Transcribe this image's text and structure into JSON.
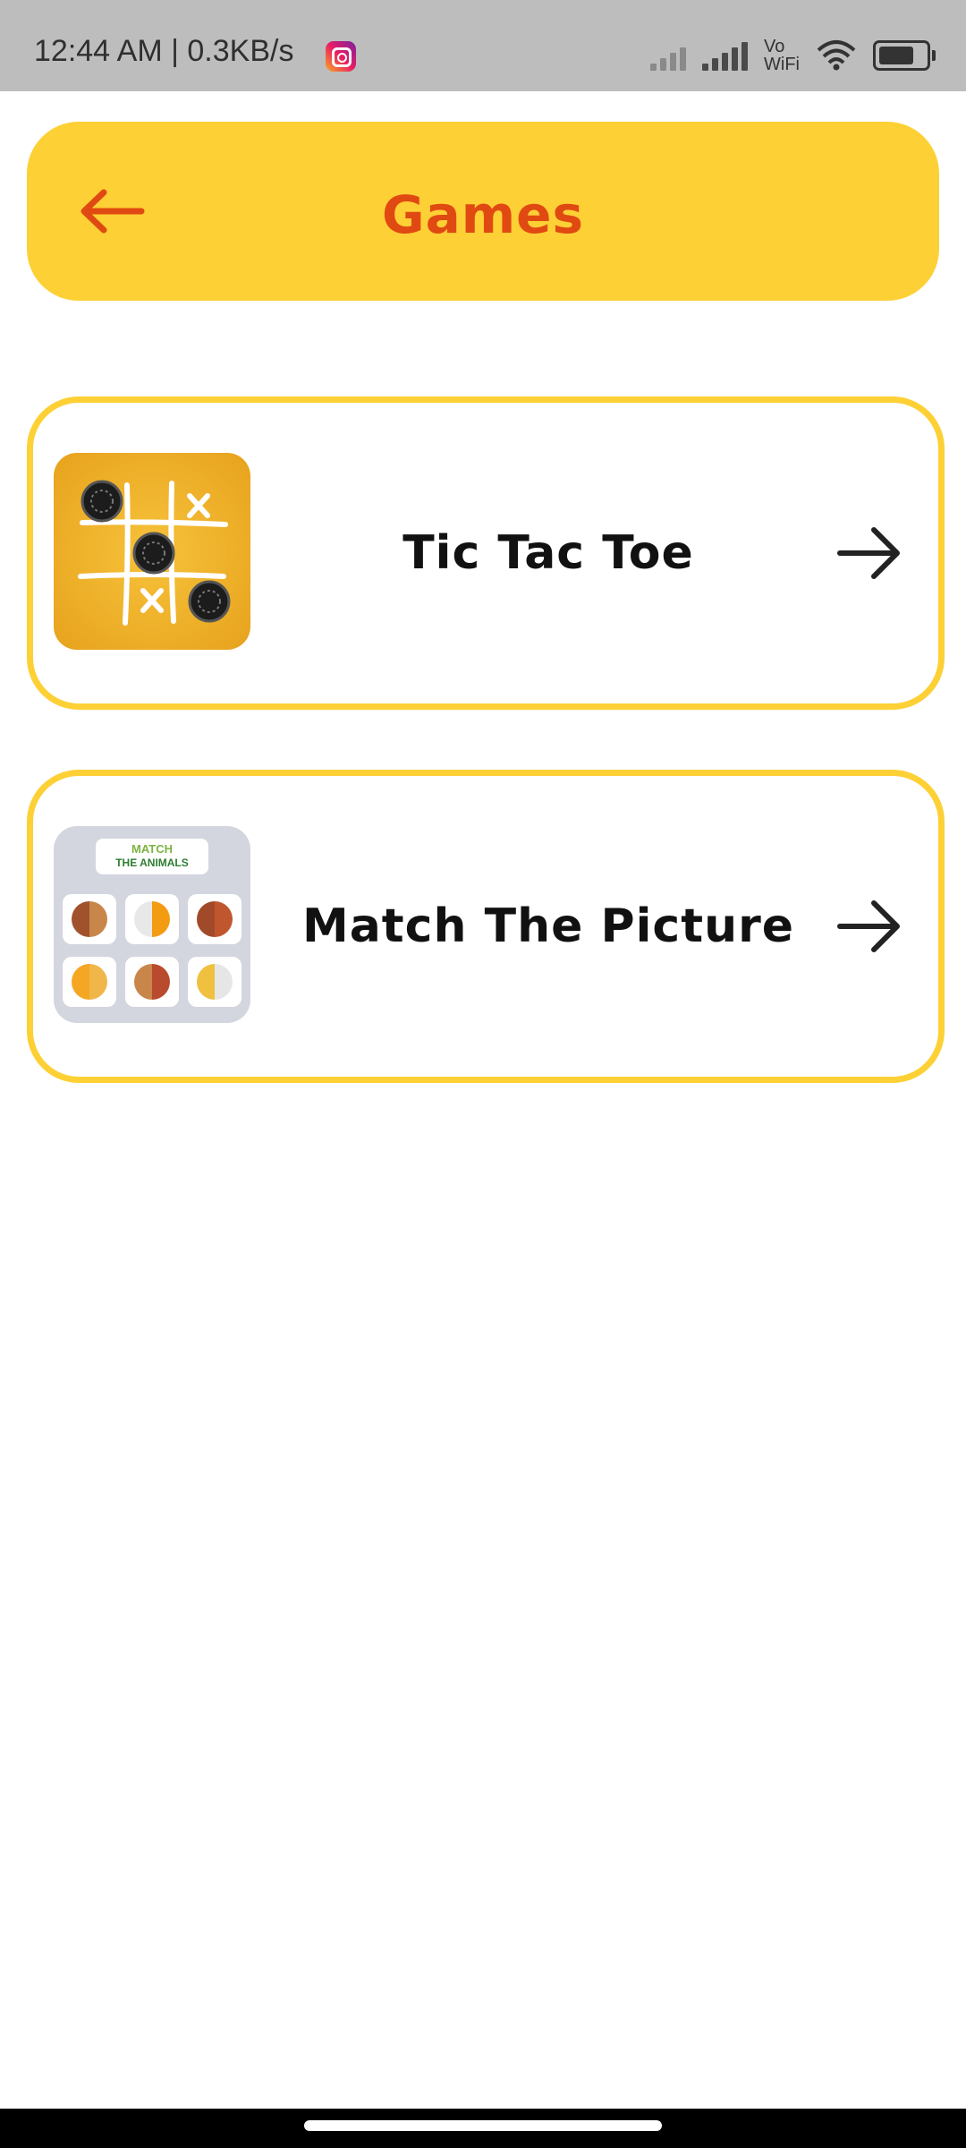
{
  "status_bar": {
    "time_speed": "12:44 AM | 0.3KB/s",
    "vowifi_line1": "Vo",
    "vowifi_line2": "WiFi",
    "icons": [
      "instagram-icon",
      "signal-icon",
      "signal-icon",
      "wifi-icon",
      "battery-icon"
    ]
  },
  "header": {
    "title": "Games",
    "back_icon": "arrow-left-icon",
    "colors": {
      "background": "#fdd035",
      "accent": "#e04a12"
    }
  },
  "games": [
    {
      "label": "Tic Tac Toe",
      "thumbnail": "tic-tac-toe-thumbnail",
      "arrow_icon": "arrow-right-icon"
    },
    {
      "label": "Match The Picture",
      "thumbnail": "match-the-animals-thumbnail",
      "arrow_icon": "arrow-right-icon",
      "thumbnail_text": {
        "line1": "MATCH",
        "line2": "THE ANIMALS"
      }
    }
  ],
  "colors": {
    "card_border": "#fdd035",
    "text": "#111111"
  }
}
